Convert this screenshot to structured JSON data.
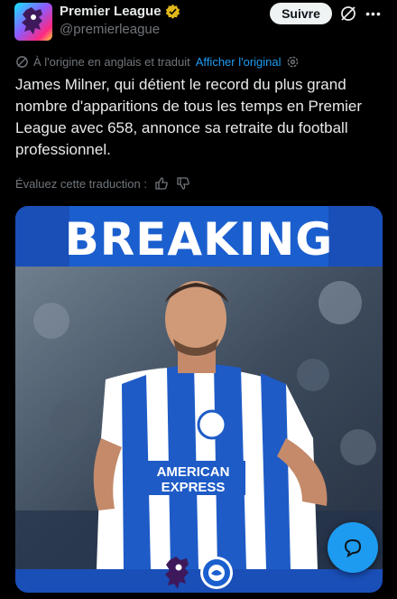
{
  "header": {
    "display_name": "Premier League",
    "handle": "@premierleague",
    "follow_label": "Suivre"
  },
  "translation": {
    "notice": "À l'origine en anglais et traduit",
    "show_original": "Afficher l'original"
  },
  "tweet": {
    "text": "James Milner, qui détient le record du plus grand nombre d'apparitions de tous les temps en Premier League avec 658, annonce sa retraite du football professionnel."
  },
  "rating": {
    "label": "Évaluez cette traduction :"
  },
  "media": {
    "banner_text": "BREAKING",
    "shirt_sponsor_line1": "AMERICAN",
    "shirt_sponsor_line2": "EXPRESS"
  },
  "colors": {
    "accent": "#1d9bf0",
    "banner_blue": "#1b5fcf",
    "background": "#000000"
  },
  "icons": {
    "verified": "verified-badge-icon",
    "grok": "grok-icon",
    "more": "more-icon",
    "translate": "translate-icon",
    "settings": "gear-icon",
    "thumbs_up": "thumbs-up-icon",
    "thumbs_down": "thumbs-down-icon",
    "compose": "compose-message-icon"
  }
}
